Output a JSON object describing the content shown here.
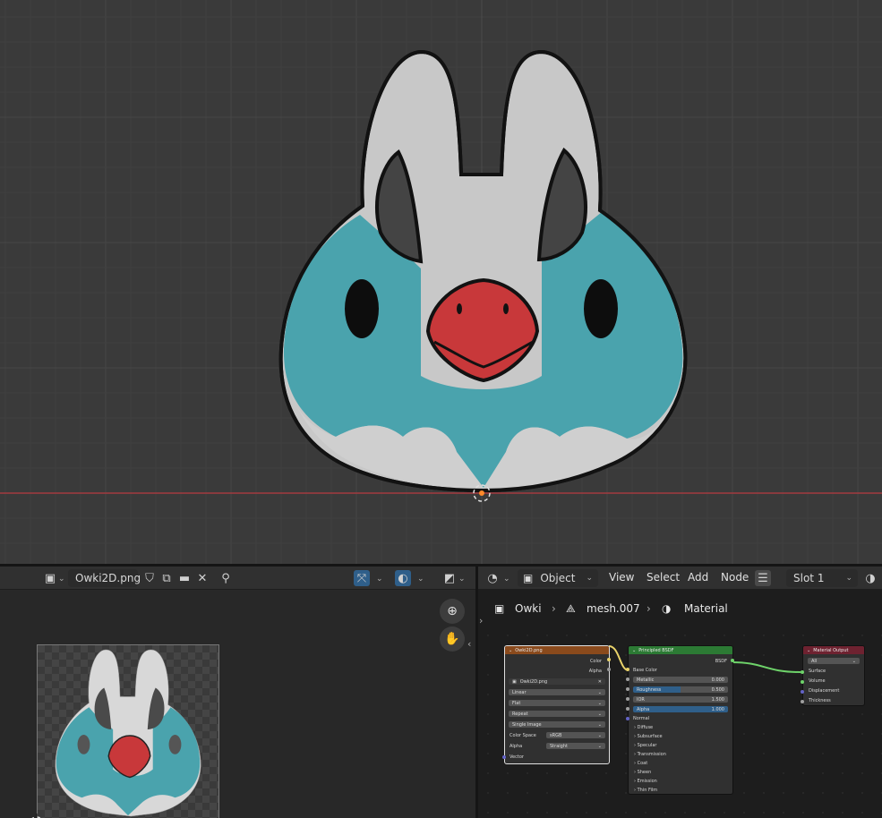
{
  "image_editor": {
    "image_name": "Owki2D.png"
  },
  "node_editor": {
    "mode": "Object",
    "menu": [
      "View",
      "Select",
      "Add",
      "Node"
    ],
    "slot": "Slot 1",
    "breadcrumb": [
      "Owki",
      "mesh.007",
      "Material"
    ],
    "nodes": {
      "image_texture": {
        "title": "Owki2D.png",
        "outputs": [
          "Color",
          "Alpha"
        ],
        "image_name": "Owki2D.png",
        "interpolation": "Linear",
        "projection": "Flat",
        "extension": "Repeat",
        "source": "Single Image",
        "color_space_label": "Color Space",
        "color_space": "sRGB",
        "alpha_label": "Alpha",
        "alpha_mode": "Straight",
        "vector_label": "Vector"
      },
      "principled": {
        "title": "Principled BSDF",
        "output": "BSDF",
        "base_color": "Base Color",
        "fields": [
          {
            "label": "Metallic",
            "value": "0.000"
          },
          {
            "label": "Roughness",
            "value": "0.500"
          },
          {
            "label": "IOR",
            "value": "1.500"
          },
          {
            "label": "Alpha",
            "value": "1.000"
          }
        ],
        "normal": "Normal",
        "panels": [
          "Diffuse",
          "Subsurface",
          "Specular",
          "Transmission",
          "Coat",
          "Sheen",
          "Emission",
          "Thin Film"
        ]
      },
      "output": {
        "title": "Material Output",
        "target": "All",
        "inputs": [
          "Surface",
          "Volume",
          "Displacement",
          "Thickness"
        ]
      }
    }
  },
  "colors": {
    "viewport_bg": "#3a3a3a",
    "x_axis": "#a33a3f",
    "teal": "#4aa3ad",
    "beak": "#c8383a",
    "horn": "#444444",
    "body_gray": "#c8c8c8",
    "image_node": "#8a4a1c",
    "shader_node": "#2c7a34",
    "output_node": "#6e2230",
    "link_yellow": "#e8d26a",
    "link_green": "#6ed36a"
  }
}
